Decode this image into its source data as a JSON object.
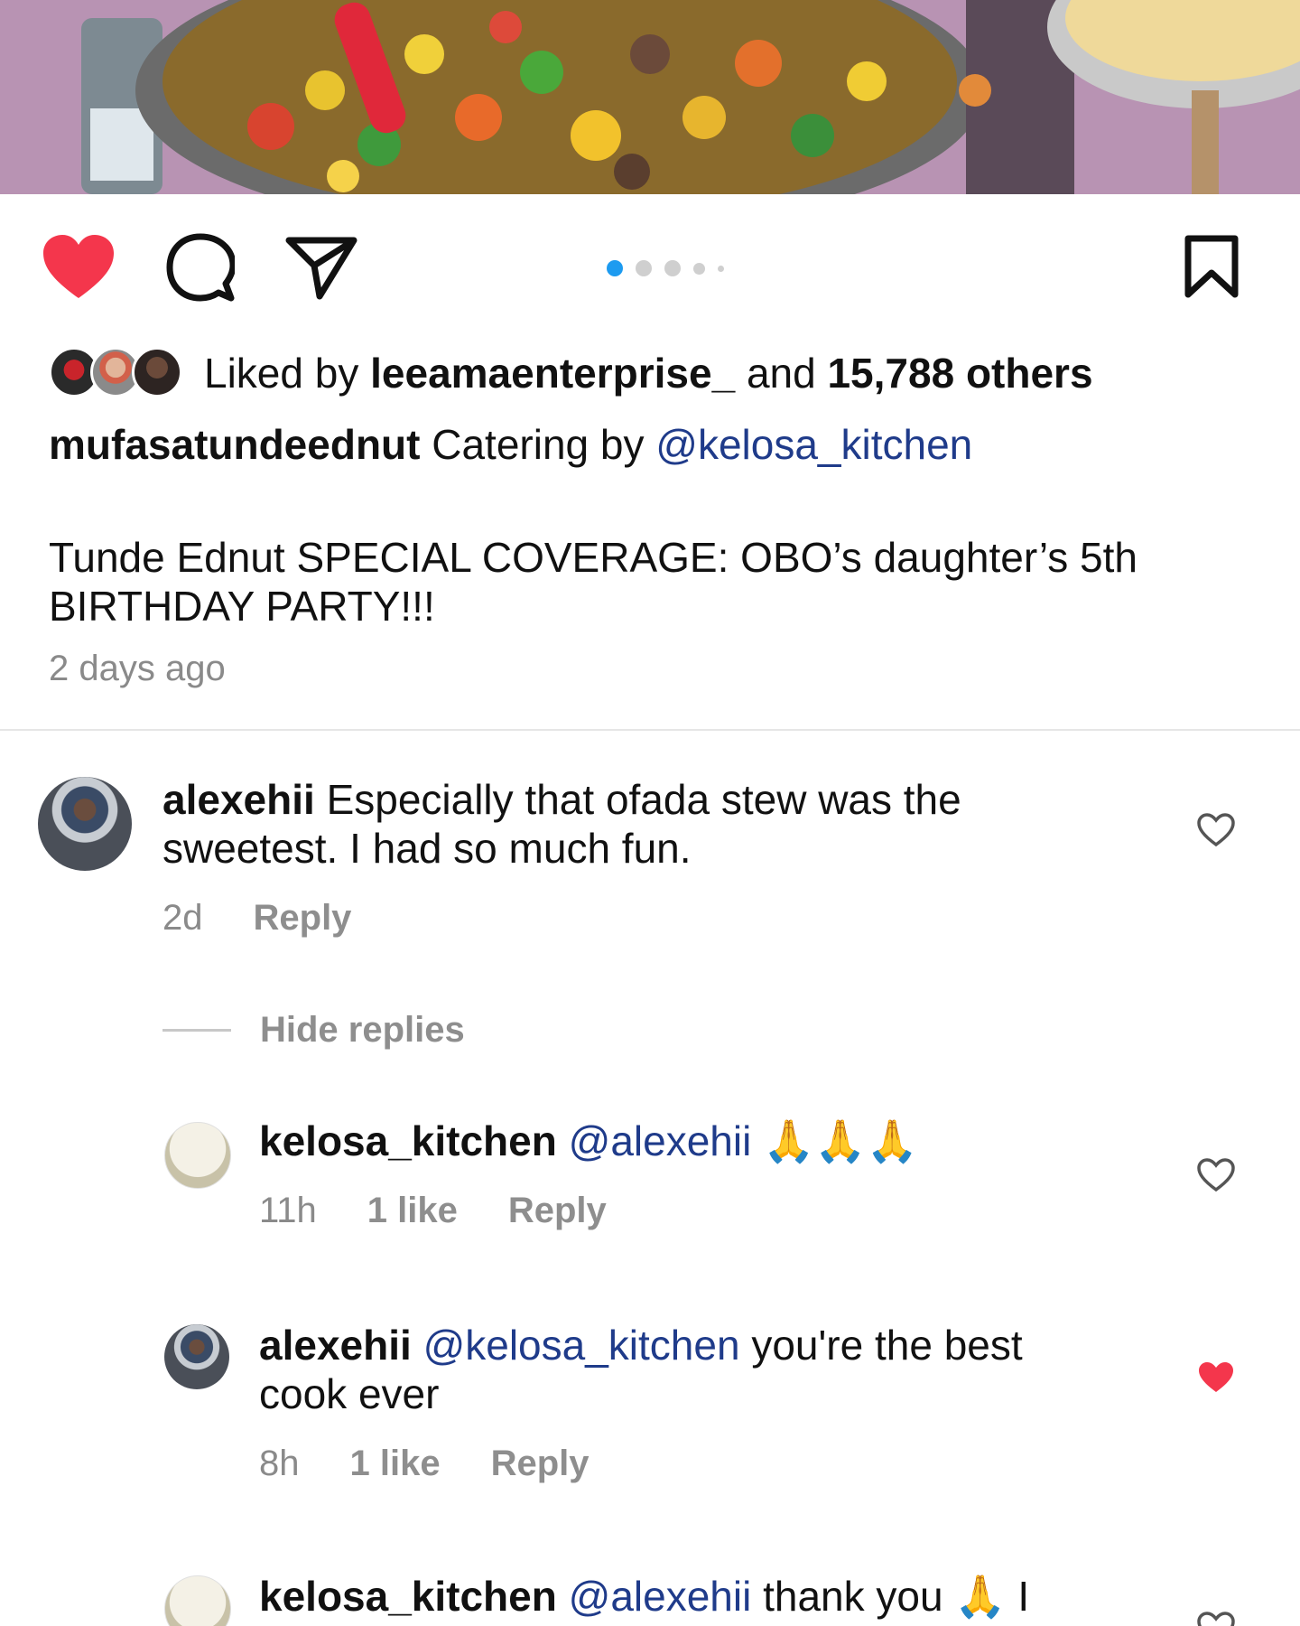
{
  "post": {
    "liked_by_prefix": "Liked by",
    "liked_by_user": "leeamaenterprise_",
    "liked_by_and": "and",
    "liked_by_others": "15,788 others",
    "author": "mufasatundeednut",
    "caption_text": "Catering by",
    "caption_mention": "@kelosa_kitchen",
    "caption_body": "Tunde Ednut SPECIAL COVERAGE: OBO’s daughter’s 5th BIRTHDAY PARTY!!!",
    "time_ago": "2 days ago",
    "carousel_active_index": 0,
    "carousel_count": 5
  },
  "comments": [
    {
      "user": "alexehii",
      "text": "Especially that ofada stew was the sweetest. I had so much fun.",
      "time": "2d",
      "reply_label": "Reply",
      "liked": false
    }
  ],
  "hide_replies_label": "Hide replies",
  "replies": [
    {
      "user": "kelosa_kitchen",
      "mention": "@alexehii",
      "text": "🙏🙏🙏",
      "time": "11h",
      "likes": "1 like",
      "reply_label": "Reply",
      "liked": false
    },
    {
      "user": "alexehii",
      "mention": "@kelosa_kitchen",
      "text": "you're the best cook ever",
      "time": "8h",
      "likes": "1 like",
      "reply_label": "Reply",
      "liked": true
    },
    {
      "user": "kelosa_kitchen",
      "mention": "@alexehii",
      "text": "thank you 🙏 I",
      "liked": false
    }
  ],
  "colors": {
    "like_red": "#f4364c",
    "carousel_active": "#1d9bf0",
    "mention_blue": "#1f3b8a",
    "muted_gray": "#8a8a8a"
  }
}
